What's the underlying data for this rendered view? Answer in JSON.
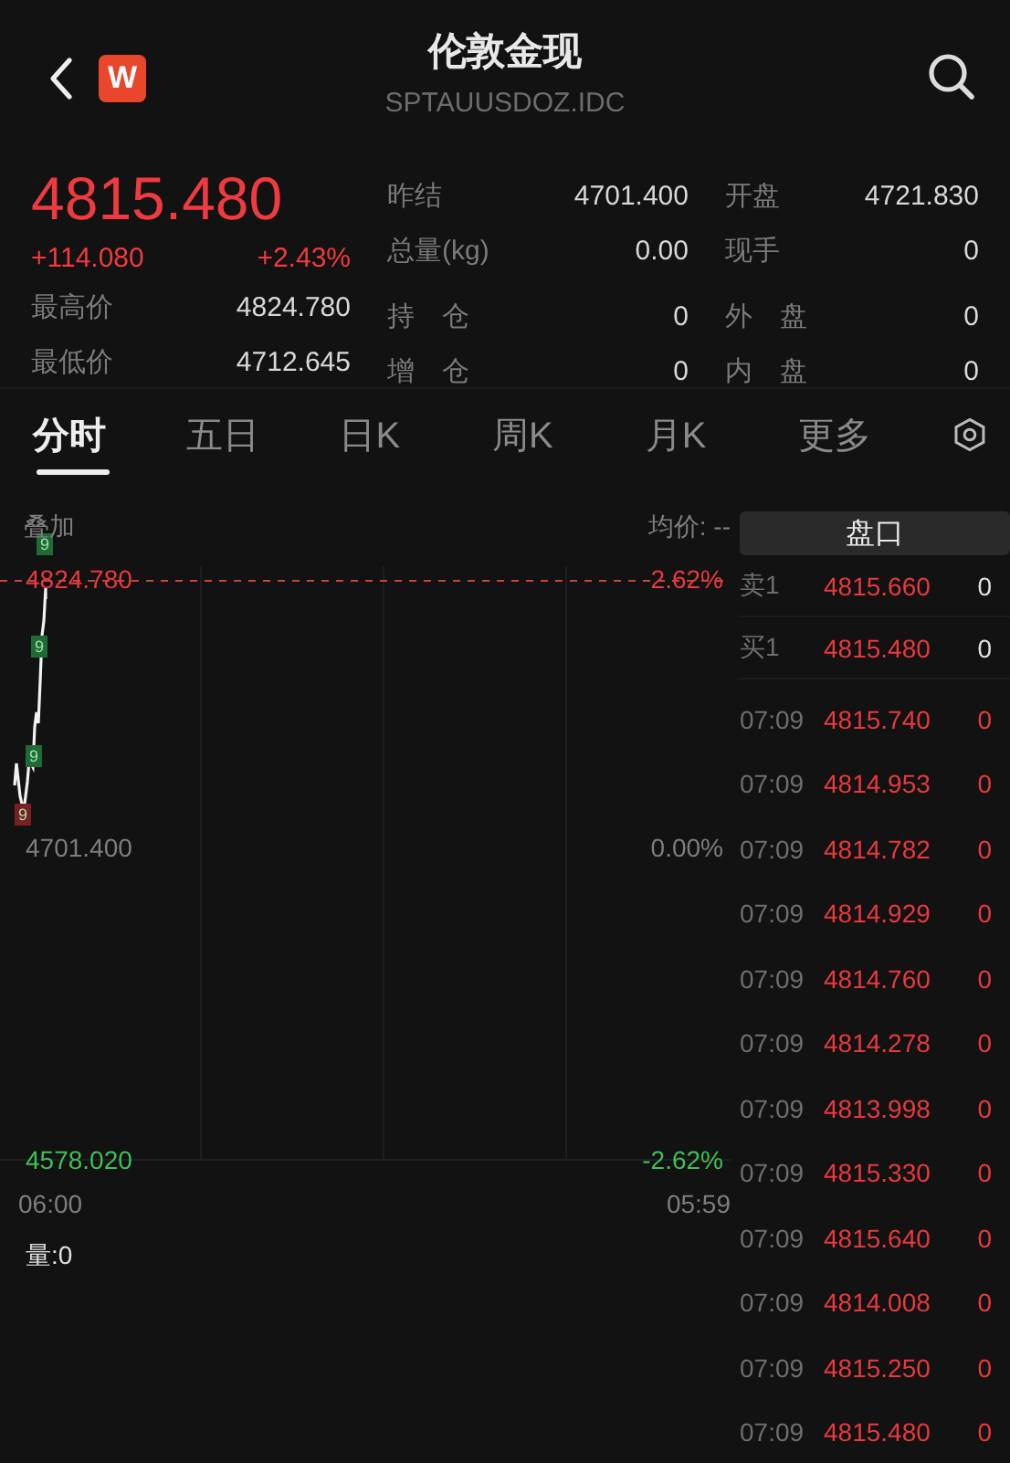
{
  "header": {
    "title": "伦敦金现",
    "code": "SPTAUUSDOZ.IDC",
    "logo": "W"
  },
  "quote": {
    "price": "4815.480",
    "change": "+114.080",
    "change_pct": "+2.43%",
    "stats_left": [
      {
        "label": "最高价",
        "value": "4824.780"
      },
      {
        "label": "最低价",
        "value": "4712.645"
      }
    ],
    "stats_mid": [
      {
        "label": "昨结",
        "value": "4701.400"
      },
      {
        "label": "总量(kg)",
        "value": "0.00"
      },
      {
        "label": "持　仓",
        "value": "0"
      },
      {
        "label": "增　仓",
        "value": "0"
      }
    ],
    "stats_right": [
      {
        "label": "开盘",
        "value": "4721.830"
      },
      {
        "label": "现手",
        "value": "0"
      },
      {
        "label": "外　盘",
        "value": "0"
      },
      {
        "label": "内　盘",
        "value": "0"
      }
    ]
  },
  "tabs": [
    {
      "label": "分时",
      "selected": true
    },
    {
      "label": "五日",
      "selected": false
    },
    {
      "label": "日K",
      "selected": false
    },
    {
      "label": "周K",
      "selected": false
    },
    {
      "label": "月K",
      "selected": false
    },
    {
      "label": "更多",
      "selected": false
    }
  ],
  "chart": {
    "overlay_label": "叠加",
    "avg_price": "均价: --",
    "high": "4824.780",
    "high_pct": "2.62%",
    "mid": "4701.400",
    "mid_pct": "0.00%",
    "low": "4578.020",
    "low_pct": "-2.62%",
    "start_time": "06:00",
    "end_time": "05:59",
    "volume": "量:0",
    "markers": [
      {
        "text": "9",
        "color": "#1e6b35"
      },
      {
        "text": "9",
        "color": "#1e6b35"
      },
      {
        "text": "9",
        "color": "#1e6b35"
      },
      {
        "text": "9",
        "color": "#7a1f24"
      }
    ]
  },
  "order_book": {
    "title": "盘口",
    "quotes": [
      {
        "label": "卖1",
        "price": "4815.660",
        "volume": "0"
      },
      {
        "label": "买1",
        "price": "4815.480",
        "volume": "0"
      }
    ],
    "trades": [
      {
        "time": "07:09",
        "price": "4815.740",
        "volume": "0"
      },
      {
        "time": "07:09",
        "price": "4814.953",
        "volume": "0"
      },
      {
        "time": "07:09",
        "price": "4814.782",
        "volume": "0"
      },
      {
        "time": "07:09",
        "price": "4814.929",
        "volume": "0"
      },
      {
        "time": "07:09",
        "price": "4814.760",
        "volume": "0"
      },
      {
        "time": "07:09",
        "price": "4814.278",
        "volume": "0"
      },
      {
        "time": "07:09",
        "price": "4813.998",
        "volume": "0"
      },
      {
        "time": "07:09",
        "price": "4815.330",
        "volume": "0"
      },
      {
        "time": "07:09",
        "price": "4815.640",
        "volume": "0"
      },
      {
        "time": "07:09",
        "price": "4814.008",
        "volume": "0"
      },
      {
        "time": "07:09",
        "price": "4815.250",
        "volume": "0"
      },
      {
        "time": "07:09",
        "price": "4815.480",
        "volume": "0"
      }
    ]
  }
}
